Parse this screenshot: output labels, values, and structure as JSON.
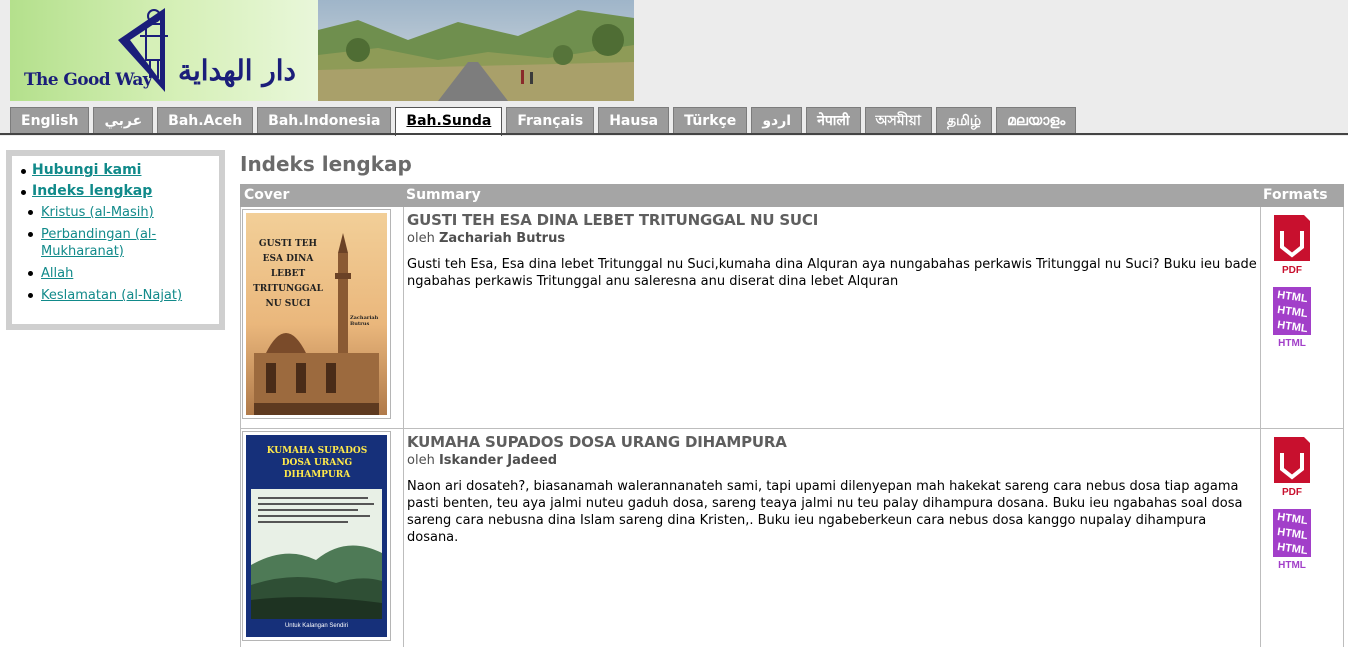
{
  "header": {
    "logo_text_en": "The Good Way",
    "logo_text_ar": "دار الهداية"
  },
  "tabs": [
    {
      "label": "English",
      "active": false
    },
    {
      "label": "عربي",
      "active": false
    },
    {
      "label": "Bah.Aceh",
      "active": false
    },
    {
      "label": "Bah.Indonesia",
      "active": false
    },
    {
      "label": "Bah.Sunda",
      "active": true
    },
    {
      "label": "Français",
      "active": false
    },
    {
      "label": "Hausa",
      "active": false
    },
    {
      "label": "Türkçe",
      "active": false
    },
    {
      "label": "اردو",
      "active": false
    },
    {
      "label": "नेपाली",
      "active": false
    },
    {
      "label": "অসমীয়া",
      "active": false
    },
    {
      "label": "தமிழ்",
      "active": false
    },
    {
      "label": "മലയാളം",
      "active": false
    }
  ],
  "sidebar": {
    "items": [
      {
        "label": "Hubungi kami"
      },
      {
        "label": "Indeks lengkap"
      }
    ],
    "subitems": [
      {
        "label": "Kristus (al-Masih)"
      },
      {
        "label": "Perbandingan (al-Mukharanat)"
      },
      {
        "label": "Allah"
      },
      {
        "label": "Keslamatan (al-Najat)"
      }
    ]
  },
  "main": {
    "title": "Indeks lengkap",
    "columns": {
      "cover": "Cover",
      "summary": "Summary",
      "formats": "Formats"
    },
    "books": [
      {
        "title": "GUSTI TEH ESA DINA LEBET TRITUNGGAL NU SUCI",
        "by_label": "oleh",
        "author": "Zachariah Butrus",
        "description": "Gusti teh Esa, Esa dina lebet Tritunggal nu Suci,kumaha dina Alquran aya nungabahas perkawis Tritunggal nu Suci? Buku ieu bade ngabahas perkawis Tritunggal anu saleresna anu diserat dina lebet Alquran",
        "cover_title": "GUSTI TEH ESA DINA LEBET TRITUNGGAL NU SUCI",
        "cover_author": "Zachariah Butrus",
        "formats": [
          "PDF",
          "HTML"
        ]
      },
      {
        "title": "KUMAHA SUPADOS DOSA URANG DIHAMPURA",
        "by_label": "oleh",
        "author": "Iskander Jadeed",
        "description": "Naon ari dosateh?, biasanamah walerannanateh sami, tapi upami dilenyepan mah hakekat sareng cara nebus dosa tiap agama pasti benten, teu aya jalmi nuteu gaduh dosa, sareng teaya jalmi nu teu palay dihampura dosana. Buku ieu ngabahas soal dosa sareng cara nebusna dina Islam sareng dina Kristen,. Buku ieu ngabeberkeun cara nebus dosa kanggo nupalay dihampura dosana.",
        "cover_title": "KUMAHA SUPADOS DOSA URANG DIHAMPURA",
        "cover_footer": "Untuk Kalangan Sendiri",
        "formats": [
          "PDF",
          "HTML"
        ]
      }
    ]
  },
  "icons": {
    "pdf": "pdf-file-icon",
    "html": "html-file-icon"
  },
  "colors": {
    "tab_bg": "#9b9b9b",
    "header_bg": "#ececec",
    "table_header_bg": "#a5a5a5",
    "link": "#118a8a",
    "logo_blue": "#1b1e7a",
    "pdf_red": "#c8102e",
    "html_purple": "#a23fc9"
  }
}
